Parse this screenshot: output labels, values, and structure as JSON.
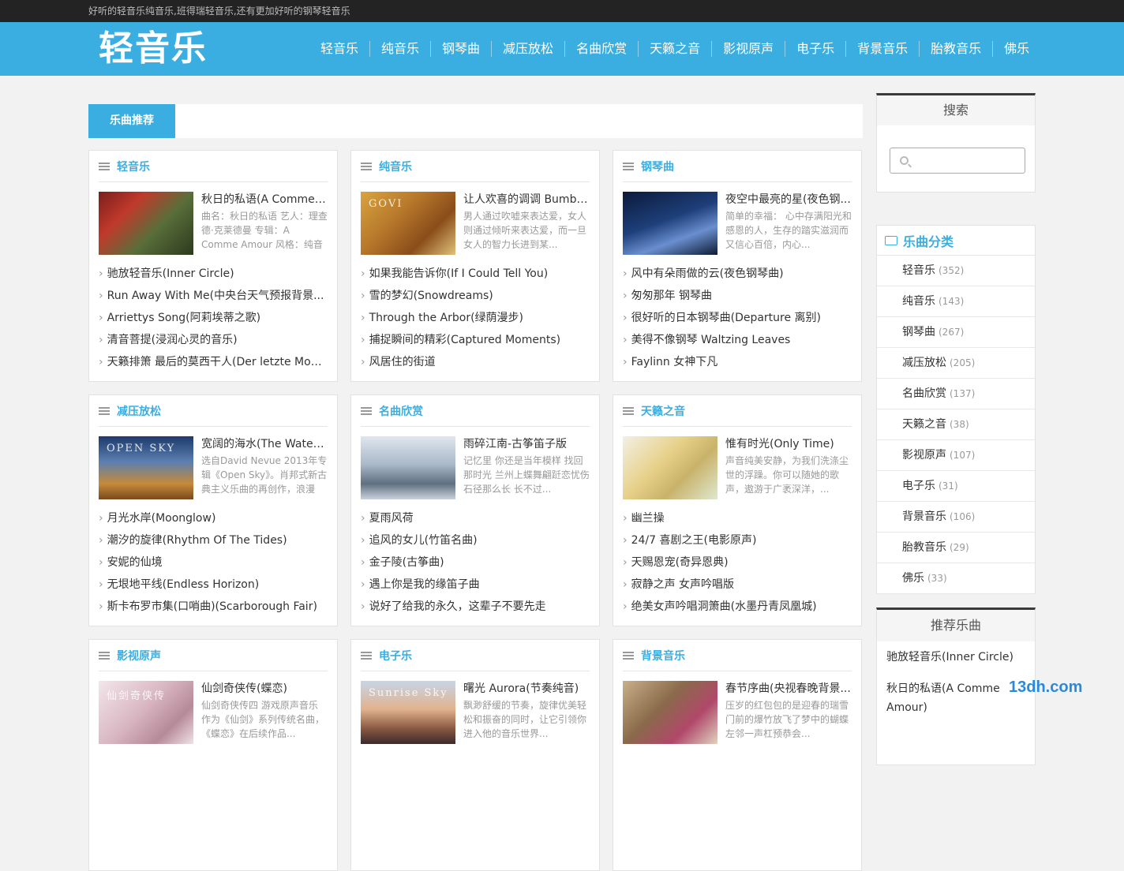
{
  "topbar": {
    "text": "好听的轻音乐纯音乐,班得瑞轻音乐,还有更加好听的钢琴轻音乐"
  },
  "logo": "轻音乐",
  "nav": [
    "轻音乐",
    "纯音乐",
    "钢琴曲",
    "减压放松",
    "名曲欣赏",
    "天籁之音",
    "影视原声",
    "电子乐",
    "背景音乐",
    "胎教音乐",
    "佛乐"
  ],
  "main": {
    "tab": "乐曲推荐"
  },
  "cards": [
    {
      "title": "轻音乐",
      "ft": "秋日的私语(A Comme ...",
      "fd": "曲名：秋日的私语 艺人：理查德·克莱德曼 专辑：A Comme Amour 风格：纯音乐，钢...",
      "items": [
        "驰放轻音乐(Inner Circle)",
        "Run Away With Me(中央台天气预报背景...",
        "Arriettys Song(阿莉埃蒂之歌)",
        "清音菩提(浸润心灵的音乐)",
        "天籁排箫 最后的莫西干人(Der letzte Mohi..."
      ]
    },
    {
      "title": "纯音乐",
      "ft": "让人欢喜的调调 Bumbl...",
      "fd": "男人通过吹嘘来表达爱，女人则通过倾听来表达爱，而一旦女人的智力长进到某...",
      "items": [
        "如果我能告诉你(If I Could Tell You)",
        "雪的梦幻(Snowdreams)",
        "Through the Arbor(绿荫漫步)",
        "捕捉瞬间的精彩(Captured Moments)",
        "风居住的街道"
      ]
    },
    {
      "title": "钢琴曲",
      "ft": "夜空中最亮的星(夜色钢...",
      "fd": "简单的幸福： 心中存满阳光和感恩的人，生存的踏实滋润而又信心百倍，内心...",
      "items": [
        "风中有朵雨做的云(夜色钢琴曲)",
        "匆匆那年 钢琴曲",
        "很好听的日本钢琴曲(Departure 离别)",
        "美得不像钢琴 Waltzing Leaves",
        "Faylinn 女神下凡"
      ]
    },
    {
      "title": "减压放松",
      "ft": "宽阔的海水(The Water ...",
      "fd": "选自David Nevue 2013年专辑《Open Sky》。肖邦式新古典主义乐曲的再创作，浪漫而...",
      "items": [
        "月光水岸(Moonglow)",
        "潮汐的旋律(Rhythm Of The Tides)",
        "安妮的仙境",
        "无垠地平线(Endless Horizon)",
        "斯卡布罗市集(口哨曲)(Scarborough Fair)"
      ]
    },
    {
      "title": "名曲欣赏",
      "ft": "雨碎江南-古筝笛子版",
      "fd": "记忆里 你还是当年模样 找回那时光 兰州上蝶舞翩跹恋忧伤 石径那么长 长不过...",
      "items": [
        "夏雨风荷",
        "追风的女儿(竹笛名曲)",
        "金子陵(古筝曲)",
        "遇上你是我的缘笛子曲",
        "说好了给我的永久，这辈子不要先走"
      ]
    },
    {
      "title": "天籁之音",
      "ft": "惟有时光(Only Time)",
      "fd": "声音纯美安静，为我们洗涤尘世的浮躁。你可以随她的歌声，遨游于广袤深洋，...",
      "items": [
        "幽兰操",
        "24/7 喜剧之王(电影原声)",
        "天赐恩宠(奇异恩典)",
        "寂静之声 女声吟唱版",
        "绝美女声吟唱洞箫曲(水墨丹青凤凰城)"
      ]
    },
    {
      "title": "影视原声",
      "ft": "仙剑奇侠传(蝶恋)",
      "fd": "仙剑奇侠传四 游戏原声音乐 作为《仙剑》系列传统名曲，《蝶恋》在后续作品...",
      "items": []
    },
    {
      "title": "电子乐",
      "ft": "曙光 Aurora(节奏纯音)",
      "fd": "飘渺舒缓的节奏，旋律优美轻松和振奋的同时，让它引领你进入他的音乐世界...",
      "items": []
    },
    {
      "title": "背景音乐",
      "ft": "春节序曲(央视春晚背景...",
      "fd": "压岁的红包包的是迎春的瑞雪 门前的爆竹放飞了梦中的蝴蝶 左邻一声杠预恭会...",
      "items": []
    }
  ],
  "side": {
    "search_title": "搜索",
    "search_placeholder": "",
    "cat_title": "乐曲分类",
    "cats": [
      {
        "name": "轻音乐",
        "count": "(352)"
      },
      {
        "name": "纯音乐",
        "count": "(143)"
      },
      {
        "name": "钢琴曲",
        "count": "(267)"
      },
      {
        "name": "减压放松",
        "count": "(205)"
      },
      {
        "name": "名曲欣赏",
        "count": "(137)"
      },
      {
        "name": "天籁之音",
        "count": "(38)"
      },
      {
        "name": "影视原声",
        "count": "(107)"
      },
      {
        "name": "电子乐",
        "count": "(31)"
      },
      {
        "name": "背景音乐",
        "count": "(106)"
      },
      {
        "name": "胎教音乐",
        "count": "(29)"
      },
      {
        "name": "佛乐",
        "count": "(33)"
      }
    ],
    "rec_title": "推荐乐曲",
    "rec": [
      "驰放轻音乐(Inner Circle)",
      "秋日的私语(A Comme Amour)"
    ]
  },
  "watermark": "13dh.com",
  "thumb_overlays": [
    "",
    "GOVI",
    "",
    "OPEN SKY",
    "",
    "",
    "仙剑奇侠传",
    "Sunrise Sky",
    ""
  ]
}
